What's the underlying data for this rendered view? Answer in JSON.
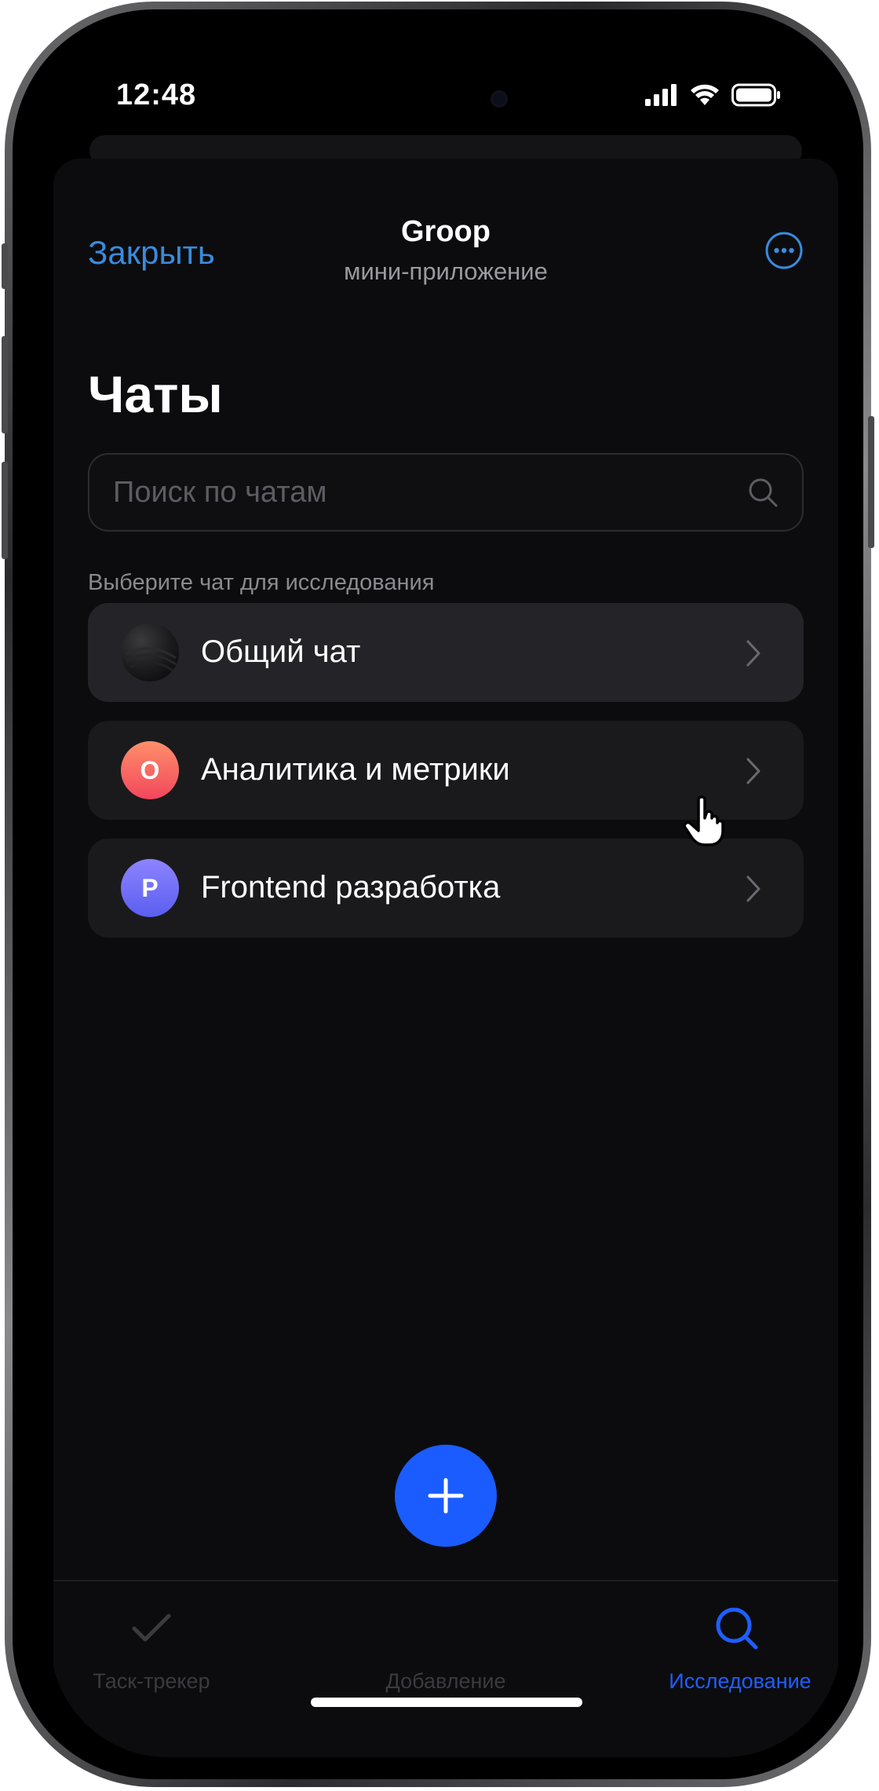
{
  "status_bar": {
    "time": "12:48"
  },
  "header": {
    "close_label": "Закрыть",
    "title": "Groop",
    "subtitle": "мини-приложение",
    "more_icon": "ellipsis-circle-icon"
  },
  "page": {
    "title": "Чаты"
  },
  "search": {
    "placeholder": "Поиск по чатам",
    "value": "",
    "icon": "search-icon"
  },
  "section_label": "Выберите чат для исследования",
  "chats": [
    {
      "label": "Общий чат",
      "avatar_letter": "",
      "avatar_colors": [
        "#3a3a3e",
        "#0a0a0c"
      ]
    },
    {
      "label": "Аналитика и метрики",
      "avatar_letter": "О",
      "avatar_colors": [
        "#ff8f6a",
        "#f2475c"
      ]
    },
    {
      "label": "Frontend разработка",
      "avatar_letter": "P",
      "avatar_colors": [
        "#8d84ff",
        "#5b5ef0"
      ]
    }
  ],
  "tabbar": {
    "tabs": [
      {
        "label": "Таск-трекер",
        "icon": "checkmark-icon",
        "color": "#3a3a40"
      },
      {
        "label": "Добавление",
        "icon": "plus-icon",
        "color": "#3a3a40"
      },
      {
        "label": "Исследование",
        "icon": "search-icon",
        "color": "#1f5eff"
      }
    ]
  },
  "colors": {
    "accent_link": "#3a8bdc",
    "fab": "#1a5cff",
    "active_tab": "#1f5eff",
    "background": "#0c0c0e"
  }
}
